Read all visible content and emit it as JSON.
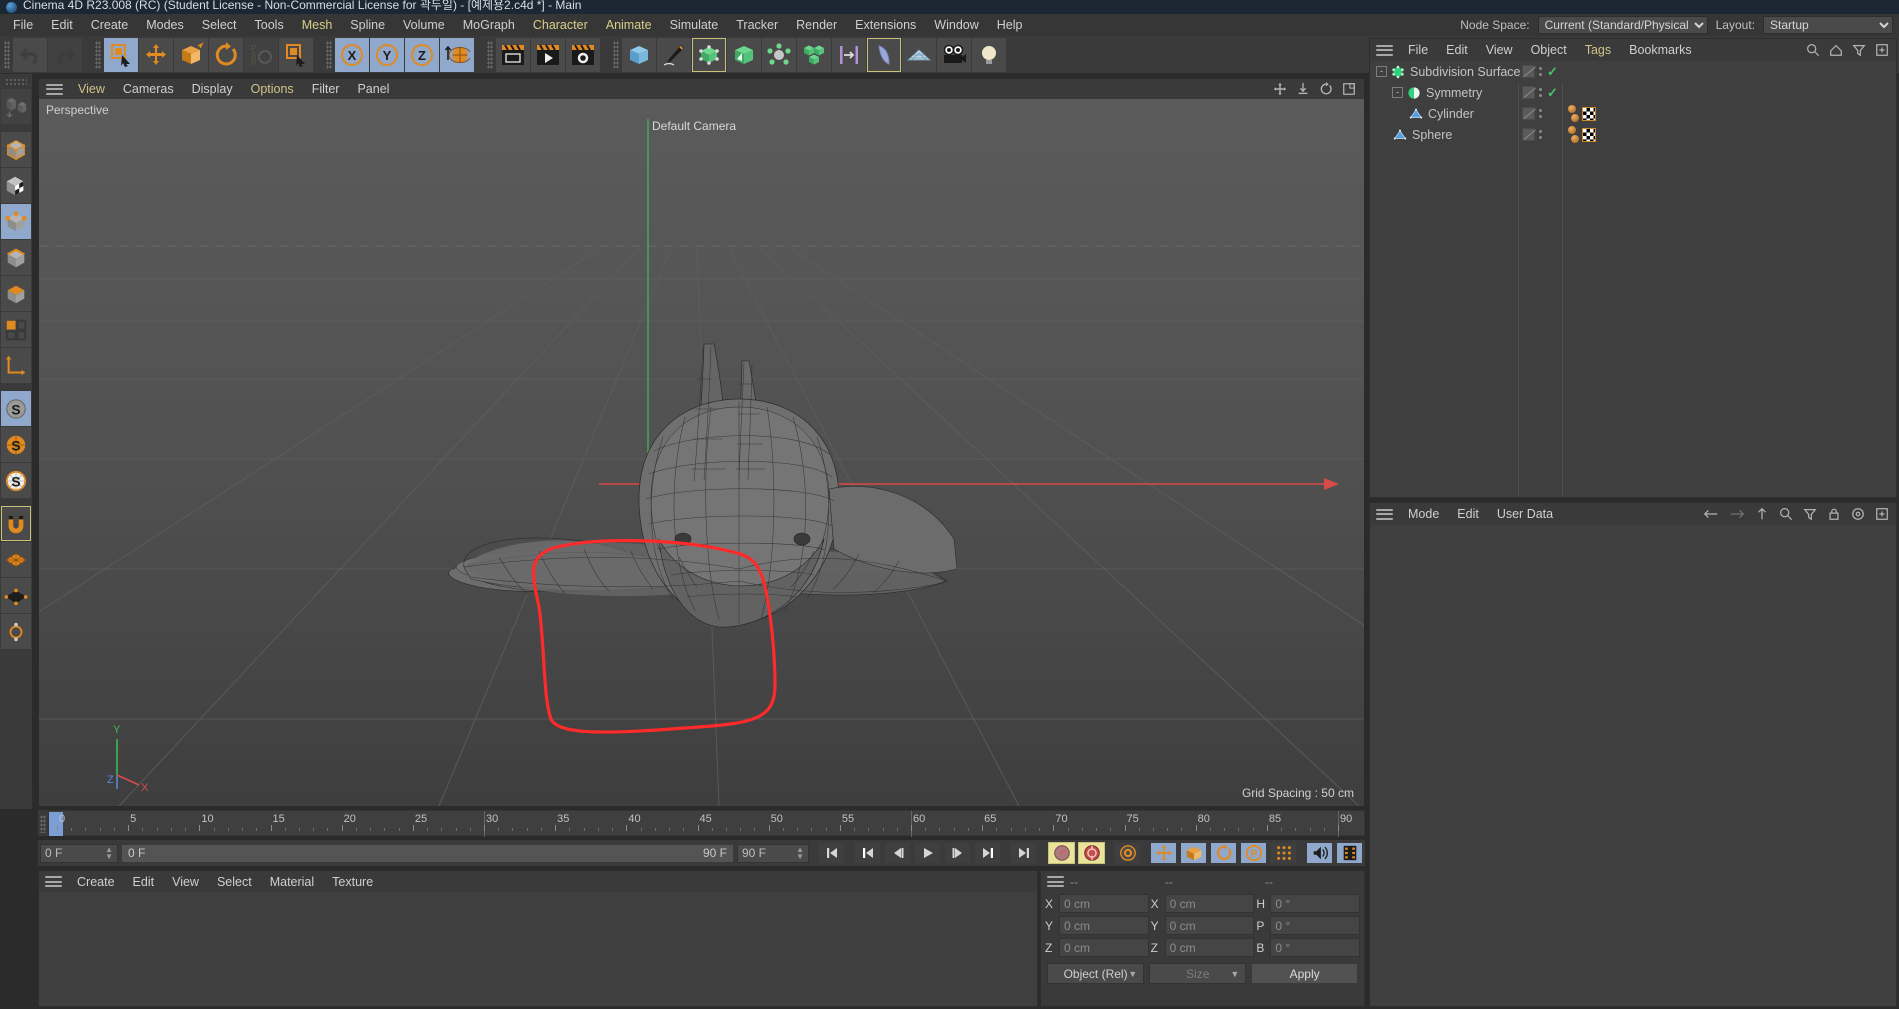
{
  "titlebar": {
    "text": "Cinema 4D R23.008 (RC) (Student License - Non-Commercial License for 곽두일) - [예제용2.c4d *] - Main",
    "icon": "c4d-logo-icon"
  },
  "menubar": {
    "items": [
      {
        "label": "File",
        "highlight": false
      },
      {
        "label": "Edit",
        "highlight": false
      },
      {
        "label": "Create",
        "highlight": false
      },
      {
        "label": "Modes",
        "highlight": false
      },
      {
        "label": "Select",
        "highlight": false
      },
      {
        "label": "Tools",
        "highlight": false
      },
      {
        "label": "Mesh",
        "highlight": true
      },
      {
        "label": "Spline",
        "highlight": false
      },
      {
        "label": "Volume",
        "highlight": false
      },
      {
        "label": "MoGraph",
        "highlight": false
      },
      {
        "label": "Character",
        "highlight": true
      },
      {
        "label": "Animate",
        "highlight": true
      },
      {
        "label": "Simulate",
        "highlight": false
      },
      {
        "label": "Tracker",
        "highlight": false
      },
      {
        "label": "Render",
        "highlight": false
      },
      {
        "label": "Extensions",
        "highlight": false
      },
      {
        "label": "Window",
        "highlight": false
      },
      {
        "label": "Help",
        "highlight": false
      }
    ],
    "node_space_label": "Node Space:",
    "node_space_value": "Current (Standard/Physical)",
    "layout_label": "Layout:",
    "layout_value": "Startup"
  },
  "toolbar": {
    "groups": [
      {
        "name": "history",
        "buttons": [
          {
            "icon": "undo-icon",
            "state": "normal"
          },
          {
            "icon": "redo-icon",
            "state": "disabled"
          }
        ]
      },
      {
        "name": "transform-tools",
        "buttons": [
          {
            "icon": "select-live-icon",
            "state": "selected"
          },
          {
            "icon": "move-icon",
            "state": "normal"
          },
          {
            "icon": "scale-icon",
            "state": "normal"
          },
          {
            "icon": "rotate-icon",
            "state": "normal"
          },
          {
            "icon": "psr-icon",
            "state": "disabled"
          },
          {
            "icon": "select-icon",
            "state": "normal"
          }
        ]
      },
      {
        "name": "axis-locks",
        "buttons": [
          {
            "icon": "x-axis-icon",
            "state": "selected"
          },
          {
            "icon": "y-axis-icon",
            "state": "selected"
          },
          {
            "icon": "z-axis-icon",
            "state": "selected"
          },
          {
            "icon": "world-axis-icon",
            "state": "selected"
          }
        ]
      },
      {
        "name": "render-tools",
        "buttons": [
          {
            "icon": "render-view-icon",
            "state": "normal"
          },
          {
            "icon": "render-picture-viewer-icon",
            "state": "normal"
          },
          {
            "icon": "render-settings-icon",
            "state": "normal"
          }
        ]
      },
      {
        "name": "object-tools",
        "buttons": [
          {
            "icon": "cube-primitive-icon",
            "state": "normal"
          },
          {
            "icon": "pen-spline-icon",
            "state": "normal"
          },
          {
            "icon": "subdivision-surface-icon",
            "state": "active"
          },
          {
            "icon": "bend-deformer-icon",
            "state": "normal"
          },
          {
            "icon": "array-icon",
            "state": "normal"
          },
          {
            "icon": "mograph-cloner-icon",
            "state": "normal"
          },
          {
            "icon": "instance-icon",
            "state": "normal"
          },
          {
            "icon": "field-icon",
            "state": "active"
          },
          {
            "icon": "floor-icon",
            "state": "normal"
          },
          {
            "icon": "camera-icon",
            "state": "normal"
          },
          {
            "icon": "light-icon",
            "state": "normal"
          }
        ]
      }
    ]
  },
  "left_toolbar": {
    "buttons": [
      {
        "icon": "make-editable-icon",
        "state": "disabled"
      },
      {
        "icon": "model-mode-icon",
        "state": "normal"
      },
      {
        "icon": "texture-mode-icon",
        "state": "normal"
      },
      {
        "icon": "points-mode-icon",
        "state": "selected"
      },
      {
        "icon": "edges-mode-icon",
        "state": "normal"
      },
      {
        "icon": "polygons-mode-icon",
        "state": "normal"
      },
      {
        "icon": "viewport-solo-icon",
        "state": "normal"
      },
      {
        "icon": "axis-modify-icon",
        "state": "normal"
      },
      {
        "icon": "enable-snap-icon",
        "state": "selected"
      },
      {
        "icon": "snap-settings-icon",
        "state": "normal"
      },
      {
        "icon": "workplane-snap-icon",
        "state": "normal"
      },
      {
        "icon": "magnet-icon",
        "state": "active"
      },
      {
        "icon": "texture-grid-icon",
        "state": "normal"
      },
      {
        "icon": "uv-mesh-icon",
        "state": "normal"
      },
      {
        "icon": "uv-points-icon",
        "state": "normal"
      }
    ]
  },
  "viewport": {
    "menu": [
      {
        "label": "View",
        "highlight": true
      },
      {
        "label": "Cameras",
        "highlight": false
      },
      {
        "label": "Display",
        "highlight": false
      },
      {
        "label": "Options",
        "highlight": true
      },
      {
        "label": "Filter",
        "highlight": false
      },
      {
        "label": "Panel",
        "highlight": false
      }
    ],
    "nav_icons": [
      "pan-icon",
      "dolly-icon",
      "rotate-view-icon",
      "maximize-view-icon"
    ],
    "corner_label": "Perspective",
    "camera_label": "Default Camera",
    "grid_spacing": "Grid Spacing : 50 cm",
    "axis_gizmo": {
      "x": "X",
      "y": "Y",
      "z": "Z"
    },
    "scene": "orca-whale-wireframe-model-with-red-lasso-selection"
  },
  "timeline": {
    "ticks": [
      0,
      5,
      10,
      15,
      20,
      25,
      30,
      35,
      40,
      45,
      50,
      55,
      60,
      65,
      70,
      75,
      80,
      85,
      90
    ],
    "current_frame_marker": 0,
    "end_frame_field": "0 F"
  },
  "powerslider": {
    "current_frame": "0 F",
    "range_start": "0 F",
    "range_end_left": "90 F",
    "range_end_right": "90 F",
    "buttons": [
      {
        "icon": "go-to-start-icon",
        "state": "dark"
      },
      {
        "icon": "go-to-previous-keyframe-icon",
        "state": "dark"
      },
      {
        "icon": "step-back-icon",
        "state": "dark"
      },
      {
        "icon": "play-icon",
        "state": "dark"
      },
      {
        "icon": "step-forward-icon",
        "state": "dark"
      },
      {
        "icon": "go-to-next-keyframe-icon",
        "state": "dark"
      },
      {
        "icon": "go-to-end-icon",
        "state": "dark"
      },
      {
        "icon": "record-active-objects-icon",
        "state": "yellow"
      },
      {
        "icon": "autokeying-icon",
        "state": "yellow"
      },
      {
        "icon": "keyframe-settings-icon",
        "state": "dark"
      },
      {
        "icon": "record-position-icon",
        "state": "blue"
      },
      {
        "icon": "record-scale-icon",
        "state": "blue"
      },
      {
        "icon": "record-rotation-icon",
        "state": "blue"
      },
      {
        "icon": "record-parameter-icon",
        "state": "blue"
      },
      {
        "icon": "record-point-level-icon",
        "state": "dark"
      },
      {
        "icon": "sound-icon",
        "state": "blue"
      },
      {
        "icon": "filmstrip-icon",
        "state": "blue"
      }
    ]
  },
  "material_manager": {
    "menu": [
      "Create",
      "Edit",
      "View",
      "Select",
      "Material",
      "Texture"
    ]
  },
  "coordinate_manager": {
    "headers": [
      "--",
      "--",
      "--"
    ],
    "rows": [
      {
        "axis1": "X",
        "value1": "0 cm",
        "axis2": "X",
        "value2": "0 cm",
        "axis3": "H",
        "value3": "0 °"
      },
      {
        "axis1": "Y",
        "value1": "0 cm",
        "axis2": "Y",
        "value2": "0 cm",
        "axis3": "P",
        "value3": "0 °"
      },
      {
        "axis1": "Z",
        "value1": "0 cm",
        "axis2": "Z",
        "value2": "0 cm",
        "axis3": "B",
        "value3": "0 °"
      }
    ],
    "mode_select": "Object (Rel)",
    "size_select": "Size",
    "apply_button": "Apply"
  },
  "object_manager": {
    "menu": [
      {
        "label": "File",
        "highlight": false
      },
      {
        "label": "Edit",
        "highlight": false
      },
      {
        "label": "View",
        "highlight": false
      },
      {
        "label": "Object",
        "highlight": false
      },
      {
        "label": "Tags",
        "highlight": true
      },
      {
        "label": "Bookmarks",
        "highlight": false
      }
    ],
    "icons": [
      "search-icon",
      "home-icon",
      "filter-icon",
      "add-icon"
    ],
    "tree": [
      {
        "label": "Subdivision Surface",
        "depth": 0,
        "icon": "subdivision-surface-icon",
        "expander": "-",
        "visibility_check": true,
        "has_material_tags": false
      },
      {
        "label": "Symmetry",
        "depth": 1,
        "icon": "symmetry-icon",
        "expander": "-",
        "visibility_check": true,
        "has_material_tags": false
      },
      {
        "label": "Cylinder",
        "depth": 2,
        "icon": "polygon-object-icon",
        "expander": "",
        "visibility_check": false,
        "has_material_tags": true
      },
      {
        "label": "Sphere",
        "depth": 0,
        "icon": "polygon-object-icon",
        "expander": "",
        "visibility_check": false,
        "has_material_tags": true
      }
    ]
  },
  "attribute_manager": {
    "menu": [
      "Mode",
      "Edit",
      "User Data"
    ],
    "icons": [
      "back-arrow-icon",
      "forward-arrow-icon",
      "up-arrow-icon",
      "search-icon",
      "filter-icon",
      "lock-icon",
      "target-icon",
      "add-icon"
    ]
  },
  "colors": {
    "accent_blue": "#8fa8cc",
    "accent_orange": "#e08a20",
    "highlight_yellow": "#cfc488",
    "panel_bg": "#3a3a3a",
    "viewport_bg": "#4e4e4e",
    "selection_red": "#ff3030",
    "check_green": "#44c46a"
  }
}
